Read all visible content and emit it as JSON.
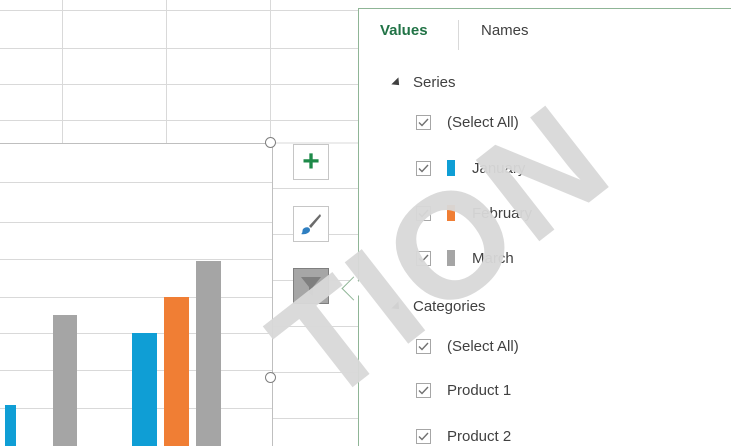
{
  "watermark": "TION",
  "chart": {
    "categories": [
      "",
      "",
      ""
    ],
    "series": [
      {
        "name": "January",
        "color": "#0f9ed5"
      },
      {
        "name": "February",
        "color": "#f07e34"
      },
      {
        "name": "March",
        "color": "#a5a5a5"
      }
    ]
  },
  "tools": {
    "elements_label": "+",
    "styles_icon": "paintbrush-icon",
    "filter_icon": "funnel-icon"
  },
  "panel": {
    "tabs": [
      {
        "label": "Values",
        "active": true
      },
      {
        "label": "Names",
        "active": false
      }
    ],
    "sections": [
      {
        "label": "Series",
        "items": [
          {
            "label": "(Select All)",
            "checked": true
          },
          {
            "label": "January",
            "checked": true,
            "color": "#0f9ed5"
          },
          {
            "label": "February",
            "checked": true,
            "color": "#f07e34"
          },
          {
            "label": "March",
            "checked": true,
            "color": "#a5a5a5"
          }
        ]
      },
      {
        "label": "Categories",
        "items": [
          {
            "label": "(Select All)",
            "checked": true
          },
          {
            "label": "Product 1",
            "checked": true
          },
          {
            "label": "Product 2",
            "checked": true
          }
        ]
      }
    ]
  }
}
